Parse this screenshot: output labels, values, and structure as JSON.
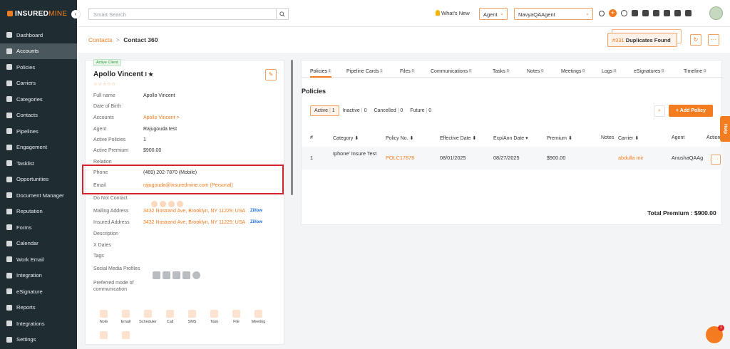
{
  "brand": {
    "logo_main": "INSURED",
    "logo_accent": "MINE"
  },
  "sidebar": {
    "items": [
      {
        "label": "Dashboard",
        "icon": "dashboard-icon"
      },
      {
        "label": "Accounts",
        "icon": "accounts-icon",
        "active": true
      },
      {
        "label": "Policies",
        "icon": "policies-icon"
      },
      {
        "label": "Carriers",
        "icon": "carriers-icon"
      },
      {
        "label": "Categories",
        "icon": "categories-icon"
      },
      {
        "label": "Contacts",
        "icon": "contacts-icon"
      },
      {
        "label": "Pipelines",
        "icon": "pipelines-icon"
      },
      {
        "label": "Engagement",
        "icon": "engagement-icon"
      },
      {
        "label": "Tasklist",
        "icon": "tasklist-icon"
      },
      {
        "label": "Opportunities",
        "icon": "opportunities-icon"
      },
      {
        "label": "Document Manager",
        "icon": "document-manager-icon"
      },
      {
        "label": "Reputation",
        "icon": "reputation-icon"
      },
      {
        "label": "Forms",
        "icon": "forms-icon"
      },
      {
        "label": "Calendar",
        "icon": "calendar-icon"
      },
      {
        "label": "Work Email",
        "icon": "work-email-icon"
      },
      {
        "label": "Integration",
        "icon": "integration-icon"
      },
      {
        "label": "eSignature",
        "icon": "esignature-icon"
      },
      {
        "label": "Reports",
        "icon": "reports-icon"
      },
      {
        "label": "Integrations",
        "icon": "integrations-icon"
      },
      {
        "label": "Settings",
        "icon": "settings-icon"
      }
    ]
  },
  "header": {
    "search_placeholder": "Smart Search",
    "whats_new": "What's New",
    "role_select": "Agent",
    "agent_select": "NavyaQAAgent"
  },
  "breadcrumb": {
    "parent": "Contacts",
    "separator": ">",
    "current": "Contact 360"
  },
  "duplicates": {
    "count": "#331",
    "label": "Duplicates Found"
  },
  "contact": {
    "status_badge": "Active Client",
    "name": "Apollo Vincent",
    "name_suffix": "I ★",
    "stars": "☆☆☆☆☆",
    "fields": [
      {
        "label": "Full name",
        "value": "Apollo Vincent"
      },
      {
        "label": "Date of Birth",
        "value": ""
      },
      {
        "label": "Accounts",
        "value": "Apollo Vincent >",
        "link": true
      },
      {
        "label": "Agent",
        "value": "Rajugouda test"
      },
      {
        "label": "Active Policies",
        "value": "1"
      },
      {
        "label": "Active Premium",
        "value": "$900.00"
      },
      {
        "label": "Relation",
        "value": ""
      },
      {
        "label": "Phone",
        "value": "(469) 202-7870 (Mobile)"
      },
      {
        "label": "Email",
        "value": "rajugouda@insuredmine.com  (Personal)",
        "link": true
      },
      {
        "label": "Do Not Contact",
        "value": ""
      },
      {
        "label": "Mailing Address",
        "value": "3432 Nostrand Ave, Brooklyn, NY 11229, USA",
        "link": true,
        "zillow": "Zillow"
      },
      {
        "label": "Insured Address",
        "value": "3432 Nostrand Ave, Brooklyn, NY 11229, USA",
        "link": true,
        "zillow": "Zillow"
      },
      {
        "label": "Description",
        "value": ""
      },
      {
        "label": "X Dates",
        "value": ""
      },
      {
        "label": "Tags",
        "value": ""
      },
      {
        "label": "Social Media Profiles",
        "value": ""
      },
      {
        "label": "Preferred mode of communication",
        "value": ""
      }
    ],
    "actions": [
      "Note",
      "Email",
      "Scheduler",
      "Call",
      "SMS",
      "Task",
      "File",
      "Meeting",
      "",
      ""
    ]
  },
  "tabs": [
    {
      "label": "Policies",
      "count": "1",
      "active": true
    },
    {
      "label": "Pipeline Cards",
      "count": "1"
    },
    {
      "label": "Files",
      "count": "0"
    },
    {
      "label": "Communications",
      "count": "0"
    },
    {
      "label": "Tasks",
      "count": "0"
    },
    {
      "label": "Notes",
      "count": "0"
    },
    {
      "label": "Meetings",
      "count": "0"
    },
    {
      "label": "Logs",
      "count": "0"
    },
    {
      "label": "eSignatures",
      "count": "0"
    },
    {
      "label": "Timeline",
      "count": "0"
    }
  ],
  "policies": {
    "title": "Policies",
    "filters": [
      {
        "label": "Active",
        "count": "1",
        "active": true
      },
      {
        "label": "Inactive",
        "count": "0"
      },
      {
        "label": "Cancelled",
        "count": "0"
      },
      {
        "label": "Future",
        "count": "0"
      }
    ],
    "add_label": "+ Add Policy",
    "columns": [
      "#",
      "Category ⬍",
      "Policy No. ⬍",
      "Effective Date ⬍",
      "Exp/Ann Date ▾",
      "Premium ⬍",
      "Notes",
      "Carrier ⬍",
      "Agent",
      "Action"
    ],
    "rows": [
      {
        "num": "1",
        "category": "Iphone' Insure Test",
        "policy_no": "POLC17878",
        "effective": "08/01/2025",
        "expiry": "08/27/2025",
        "premium": "$900.00",
        "notes": "",
        "carrier": "abdulla mir",
        "agent": "AnushaQAAg",
        "menu": "···"
      }
    ],
    "total_label": "Total Premium : $900.00"
  },
  "help_label": "Help",
  "chat_badge": "1"
}
